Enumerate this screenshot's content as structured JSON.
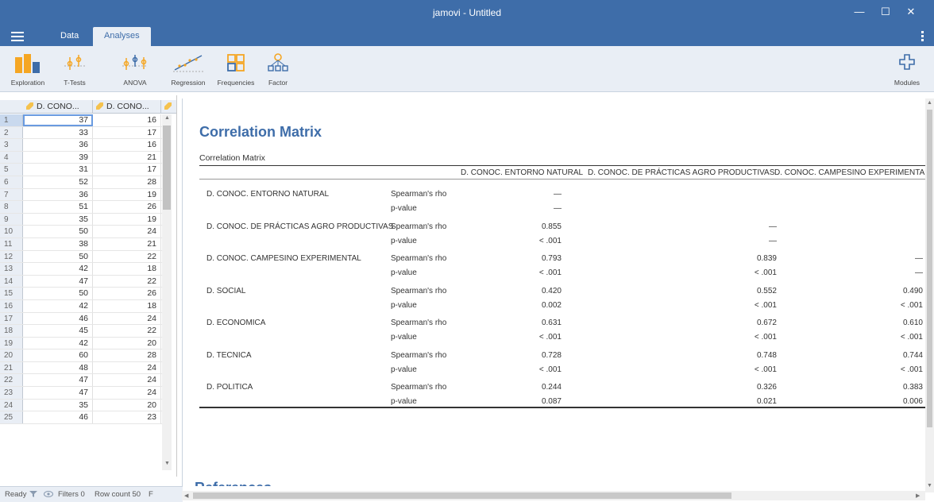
{
  "window": {
    "title": "jamovi - Untitled",
    "min": "—",
    "max": "☐",
    "close": "✕"
  },
  "tabs": [
    {
      "label": "Data"
    },
    {
      "label": "Analyses"
    }
  ],
  "ribbon": [
    {
      "label": "Exploration",
      "icon": "exploration-icon"
    },
    {
      "label": "T-Tests",
      "icon": "t-tests-icon"
    },
    {
      "label": "ANOVA",
      "icon": "anova-icon"
    },
    {
      "label": "Regression",
      "icon": "regression-icon"
    },
    {
      "label": "Frequencies",
      "icon": "frequencies-icon"
    },
    {
      "label": "Factor",
      "icon": "factor-icon"
    },
    {
      "label": "Modules",
      "icon": "modules-icon"
    }
  ],
  "sheet": {
    "columns": [
      "D. CONO...",
      "D. CONO..."
    ],
    "rows": [
      [
        37,
        16
      ],
      [
        33,
        17
      ],
      [
        36,
        16
      ],
      [
        39,
        21
      ],
      [
        31,
        17
      ],
      [
        52,
        28
      ],
      [
        36,
        19
      ],
      [
        51,
        26
      ],
      [
        35,
        19
      ],
      [
        50,
        24
      ],
      [
        38,
        21
      ],
      [
        50,
        22
      ],
      [
        42,
        18
      ],
      [
        47,
        22
      ],
      [
        50,
        26
      ],
      [
        42,
        18
      ],
      [
        46,
        24
      ],
      [
        45,
        22
      ],
      [
        42,
        20
      ],
      [
        60,
        28
      ],
      [
        48,
        24
      ],
      [
        47,
        24
      ],
      [
        47,
        24
      ],
      [
        35,
        20
      ],
      [
        46,
        23
      ]
    ]
  },
  "status": {
    "ready": "Ready",
    "filters": "Filters 0",
    "rowcount": "Row count 50",
    "extra": "F"
  },
  "results": {
    "title": "Correlation Matrix",
    "caption": "Correlation Matrix",
    "headers": [
      "D. CONOC. ENTORNO NATURAL",
      "D. CONOC. DE PRÁCTICAS AGRO PRODUCTIVAS",
      "D. CONOC. CAMPESINO EXPERIMENTAL"
    ],
    "rows": [
      {
        "label": "D. CONOC. ENTORNO NATURAL",
        "rho": [
          "—",
          "",
          ""
        ],
        "p": [
          "—",
          "",
          ""
        ]
      },
      {
        "label": "D. CONOC. DE PRÁCTICAS AGRO PRODUCTIVAS",
        "rho": [
          "0.855",
          "—",
          ""
        ],
        "p": [
          "< .001",
          "—",
          ""
        ]
      },
      {
        "label": "D. CONOC. CAMPESINO EXPERIMENTAL",
        "rho": [
          "0.793",
          "0.839",
          "—"
        ],
        "p": [
          "< .001",
          "< .001",
          "—"
        ]
      },
      {
        "label": "D. SOCIAL",
        "rho": [
          "0.420",
          "0.552",
          "0.490"
        ],
        "p": [
          "0.002",
          "< .001",
          "< .001"
        ]
      },
      {
        "label": "D. ECONOMICA",
        "rho": [
          "0.631",
          "0.672",
          "0.610"
        ],
        "p": [
          "< .001",
          "< .001",
          "< .001"
        ]
      },
      {
        "label": "D. TECNICA",
        "rho": [
          "0.728",
          "0.748",
          "0.744"
        ],
        "p": [
          "< .001",
          "< .001",
          "< .001"
        ]
      },
      {
        "label": "D. POLITICA",
        "rho": [
          "0.244",
          "0.326",
          "0.383"
        ],
        "p": [
          "0.087",
          "0.021",
          "0.006"
        ]
      }
    ],
    "stat_rho": "Spearman's rho",
    "stat_p": "p-value",
    "references": "References"
  }
}
